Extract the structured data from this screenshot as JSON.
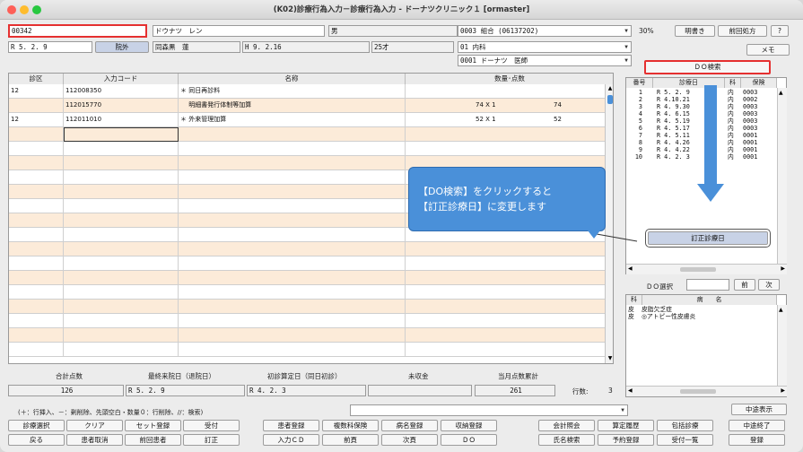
{
  "window": {
    "title": "(K02)診療行為入力－診療行為入力 - ドーナツクリニック１ [ormaster]"
  },
  "patient": {
    "id": "00342",
    "name": "ドウナツ　レン",
    "sex": "男",
    "insurance": "0003 組合 (06137202)",
    "ratio": "30%",
    "visit_date": "R 5. 2. 9",
    "visit_type": "院外",
    "institution": "同森黒　蓮",
    "birthdate": "H 9. 2.16",
    "age": "25才",
    "department": "01 内科",
    "doctor": "0001 ドーナツ　医師"
  },
  "buttons": {
    "receipt": "明書き",
    "prev_rx": "前回処方",
    "help": "?",
    "memo": "メモ",
    "do_search": "ＤＯ検索",
    "teisei": "訂正診療日",
    "next_btn": "前",
    "nextp": "次"
  },
  "grid": {
    "headers": [
      "診区",
      "入力コード",
      "名称",
      "数量･点数"
    ],
    "rows": [
      {
        "ku": "12",
        "code": "112008350",
        "name": "＊ 同日再診料",
        "qty": "",
        "pts": ""
      },
      {
        "ku": "",
        "code": "112015770",
        "name": "　 明細書発行体制等加算",
        "qty": "74 X 1",
        "pts": "74"
      },
      {
        "ku": "12",
        "code": "112011010",
        "name": "＊ 外来管理加算",
        "qty": "52 X 1",
        "pts": "52"
      }
    ]
  },
  "do_list": {
    "headers": [
      "番号",
      "診療日",
      "科",
      "保険"
    ],
    "rows": [
      [
        "1",
        "R 5. 2. 9",
        "内",
        "0003"
      ],
      [
        "2",
        "R 4.10.21",
        "内",
        "0002"
      ],
      [
        "3",
        "R 4. 9.30",
        "内",
        "0003"
      ],
      [
        "4",
        "R 4. 6.15",
        "内",
        "0003"
      ],
      [
        "5",
        "R 4. 5.19",
        "内",
        "0003"
      ],
      [
        "6",
        "R 4. 5.17",
        "内",
        "0003"
      ],
      [
        "7",
        "R 4. 5.11",
        "内",
        "0001"
      ],
      [
        "8",
        "R 4. 4.26",
        "内",
        "0001"
      ],
      [
        "9",
        "R 4. 4.22",
        "内",
        "0001"
      ],
      [
        "10",
        "R 4. 2. 3",
        "内",
        "0001"
      ]
    ]
  },
  "do_select": {
    "label": "ＤＯ選択",
    "value": ""
  },
  "disease": {
    "headers": [
      "科",
      "病　　名"
    ],
    "rows": [
      [
        "皮",
        "皮脂欠乏症"
      ],
      [
        "皮",
        "◎アトピー性皮膚炎"
      ]
    ]
  },
  "callout": {
    "line1": "【DO検索】をクリックすると",
    "line2": "【訂正診療日】に変更します"
  },
  "summary": {
    "total_label": "合計点数",
    "total": "126",
    "last_label": "最終来院日（退院日）",
    "last": "R 5. 2. 9",
    "first_label": "初診算定日（同日初診）",
    "first": "R 4. 2. 3",
    "unpaid_label": "未収金",
    "unpaid": "",
    "month_label": "当月点数累計",
    "month": "261",
    "lines_label": "行数:",
    "lines": "3"
  },
  "hint": "(＋：行挿入、－：剰削除、先頭空白・数量０：行削除、//：検索)",
  "midway": "中途表示",
  "fbtns": [
    [
      "診療選択",
      "クリア",
      "セット登録",
      "受付",
      "患者登録",
      "複数科保険",
      "病名登録",
      "収納登録",
      "会計照会",
      "算定履歴",
      "包括診療",
      "中途終了"
    ],
    [
      "戻る",
      "患者取消",
      "前回患者",
      "訂正",
      "入力ＣＤ",
      "前頁",
      "次頁",
      "ＤＯ",
      "氏名検索",
      "予約登録",
      "受付一覧",
      "登録"
    ]
  ],
  "colors": {
    "accent_red": "#e53030",
    "callout": "#4a90d9",
    "row_alt": "#fcebd9"
  }
}
